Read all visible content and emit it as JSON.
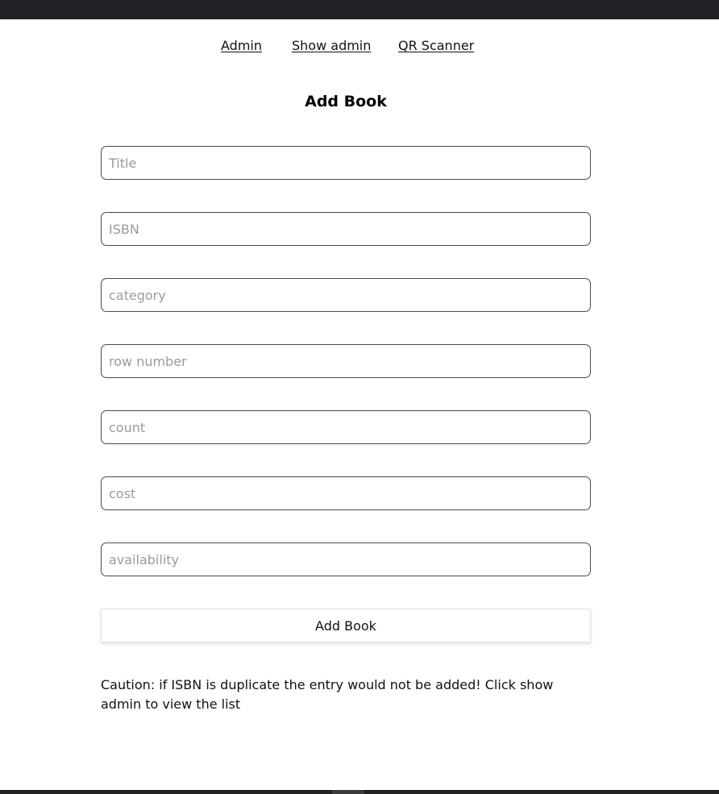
{
  "nav": {
    "admin": "Admin",
    "show_admin": "Show admin",
    "qr_scanner": "QR Scanner"
  },
  "form": {
    "title": "Add Book",
    "fields": {
      "title": {
        "placeholder": "Title",
        "value": ""
      },
      "isbn": {
        "placeholder": "ISBN",
        "value": ""
      },
      "category": {
        "placeholder": "category",
        "value": ""
      },
      "row_number": {
        "placeholder": "row number",
        "value": ""
      },
      "count": {
        "placeholder": "count",
        "value": ""
      },
      "cost": {
        "placeholder": "cost",
        "value": ""
      },
      "availability": {
        "placeholder": "availability",
        "value": ""
      }
    },
    "submit_label": "Add Book",
    "caution": "Caution: if ISBN is duplicate the entry would not be added! Click show admin to view the list"
  }
}
